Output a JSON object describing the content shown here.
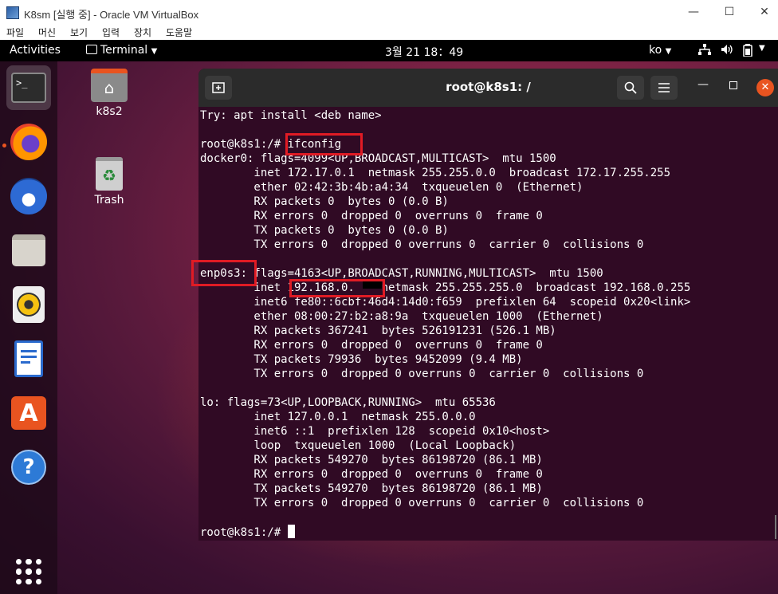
{
  "vbox": {
    "title": "K8sm [실행 중] - Oracle VM VirtualBox",
    "menu": [
      "파일",
      "머신",
      "보기",
      "입력",
      "장치",
      "도움말"
    ],
    "minimize": "—",
    "maximize": "☐",
    "close": "✕"
  },
  "topbar": {
    "activities": "Activities",
    "app_menu": "Terminal",
    "clock": "3월 21  18：49",
    "input_method": "ko"
  },
  "desktop": {
    "icons": [
      {
        "label": "k8s2",
        "icon": "home-folder-icon"
      },
      {
        "label": "Trash",
        "icon": "trash-icon"
      }
    ]
  },
  "dock": {
    "items": [
      "terminal-icon",
      "firefox-icon",
      "thunderbird-icon",
      "files-icon",
      "rhythmbox-icon",
      "libreoffice-writer-icon",
      "software-icon",
      "help-icon",
      "show-apps-icon"
    ]
  },
  "terminal": {
    "title": "root@k8s1: /",
    "lines": [
      "Try: apt install <deb name>",
      "",
      "root@k8s1:/# ifconfig",
      "docker0: flags=4099<UP,BROADCAST,MULTICAST>  mtu 1500",
      "        inet 172.17.0.1  netmask 255.255.0.0  broadcast 172.17.255.255",
      "        ether 02:42:3b:4b:a4:34  txqueuelen 0  (Ethernet)",
      "        RX packets 0  bytes 0 (0.0 B)",
      "        RX errors 0  dropped 0  overruns 0  frame 0",
      "        TX packets 0  bytes 0 (0.0 B)",
      "        TX errors 0  dropped 0 overruns 0  carrier 0  collisions 0",
      "",
      "enp0s3: flags=4163<UP,BROADCAST,RUNNING,MULTICAST>  mtu 1500",
      "        inet 192.168.0.    netmask 255.255.255.0  broadcast 192.168.0.255",
      "        inet6 fe80::6cbf:46d4:14d0:f659  prefixlen 64  scopeid 0x20<link>",
      "        ether 08:00:27:b2:a8:9a  txqueuelen 1000  (Ethernet)",
      "        RX packets 367241  bytes 526191231 (526.1 MB)",
      "        RX errors 0  dropped 0  overruns 0  frame 0",
      "        TX packets 79936  bytes 9452099 (9.4 MB)",
      "        TX errors 0  dropped 0 overruns 0  carrier 0  collisions 0",
      "",
      "lo: flags=73<UP,LOOPBACK,RUNNING>  mtu 65536",
      "        inet 127.0.0.1  netmask 255.0.0.0",
      "        inet6 ::1  prefixlen 128  scopeid 0x10<host>",
      "        loop  txqueuelen 1000  (Local Loopback)",
      "        RX packets 549270  bytes 86198720 (86.1 MB)",
      "        RX errors 0  dropped 0  overruns 0  frame 0",
      "        TX packets 549270  bytes 86198720 (86.1 MB)",
      "        TX errors 0  dropped 0 overruns 0  carrier 0  collisions 0",
      "",
      "root@k8s1:/# "
    ]
  },
  "colors": {
    "terminal_bg": "#300a24",
    "highlight": "#e01b24",
    "ubuntu_orange": "#e95420"
  }
}
